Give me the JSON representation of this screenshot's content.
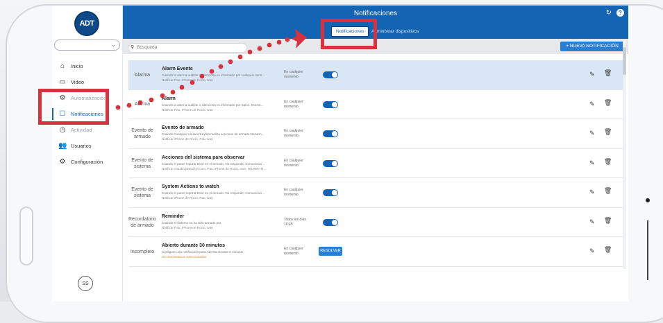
{
  "header": {
    "title": "Notificaciones",
    "tabs": [
      {
        "label": "Notificaciones",
        "active": true
      },
      {
        "label": "Administrar dispositivos",
        "active": false
      }
    ],
    "help_label": "?"
  },
  "sidebar": {
    "logo_text": "ADT",
    "items": [
      {
        "label": "Inicio",
        "icon": "home-icon",
        "glyph": "⌂"
      },
      {
        "label": "Video",
        "icon": "video-icon",
        "glyph": "▭"
      },
      {
        "label": "Automatización",
        "icon": "automation-icon",
        "glyph": "⚙"
      },
      {
        "label": "Notificaciones",
        "icon": "notification-icon",
        "glyph": "☐",
        "active": true
      },
      {
        "label": "Actividad",
        "icon": "activity-icon",
        "glyph": "◷"
      },
      {
        "label": "Usuarios",
        "icon": "users-icon",
        "glyph": "👥"
      },
      {
        "label": "Configuración",
        "icon": "settings-icon",
        "glyph": "⚙"
      }
    ],
    "avatar_initials": "SS"
  },
  "toolbar": {
    "search_placeholder": "Búsqueda",
    "new_button_label": "+ NUEVA NOTIFICACIÓN"
  },
  "rows": [
    {
      "type": "Alarma",
      "name": "Alarm Events",
      "desc": "Cuando la alarma audible o silenciosa es informado por cualquier sens...",
      "recipients": "Notificar Pau, iPhone de Rocio, Ivan",
      "when": "En cualquier momento",
      "control": "toggle",
      "selected": true
    },
    {
      "type": "Alarma",
      "name": "Alarm",
      "desc": "Cuando la alarma audible o silenciosa es informado por Salon, Dormit...",
      "recipients": "Notificar Pau, iPhone de Rocio, Ivan",
      "when": "En cualquier momento",
      "control": "toggle",
      "selected": false
    },
    {
      "type": "Evento de armado",
      "name": "Evento de armado",
      "desc": "Cuando Cualquier usuario/Keyfob realiza acciones de armado Desarm...",
      "recipients": "Notificar iPhone de Rocio, Pau, Ivan",
      "when": "En cualquier momento",
      "control": "toggle",
      "selected": false
    },
    {
      "type": "Evento de sistema",
      "name": "Acciones del sistema para observar",
      "desc": "Cuando el panel reporta Error en el armado, No responde, Comunicaci...",
      "recipients": "Notificar claudio.pinto@jci.com, Pau, iPhone de Rocio, Ivan, HUAWEI R...",
      "when": "En cualquier momento",
      "control": "toggle",
      "selected": false
    },
    {
      "type": "Evento de sistema",
      "name": "System Actions to watch",
      "desc": "Cuando el panel reporta Error en el armado, No responde, Comunicaci...",
      "recipients": "Notificar iPhone de Rocio, Pau, Ivan",
      "when": "En cualquier momento",
      "control": "toggle",
      "selected": false
    },
    {
      "type": "Recordatorio de armado",
      "name": "Reminder",
      "desc": "Cuando el sistema no ha sido armado por",
      "recipients": "Notificar Pau, iPhone de Rocio, Ivan",
      "when": "Todos los días 16:45",
      "control": "toggle",
      "selected": false
    },
    {
      "type": "Incompleto",
      "name": "Abierto durante 30 minutos",
      "desc": "Configure una notificación para Abierto durante 0 minutos.",
      "recipients": "Sin destinatarios seleccionados",
      "recipients_warn": true,
      "when": "En cualquier momento",
      "control": "resolve",
      "resolve_label": "RESOLVER",
      "selected": false
    }
  ],
  "colors": {
    "brand": "#1464b4",
    "highlight": "#d6333f",
    "warning": "#e58a2a"
  }
}
